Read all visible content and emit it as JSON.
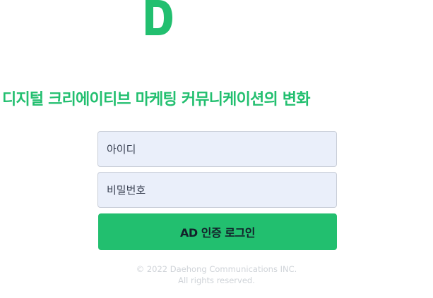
{
  "brand": {
    "logo_letter": "D",
    "logo_color": "#22bf6f"
  },
  "tagline": "디지털 크리에이티브 마케팅 커뮤니케이션의 변화",
  "form": {
    "id_placeholder": "아이디",
    "password_placeholder": "비밀번호",
    "login_label": "AD 인증 로그인"
  },
  "footer": {
    "copyright": "© 2022 Daehong Communications INC.",
    "rights": "All rights reserved."
  },
  "colors": {
    "accent": "#22bf6f",
    "input_bg": "#eaeffa"
  }
}
